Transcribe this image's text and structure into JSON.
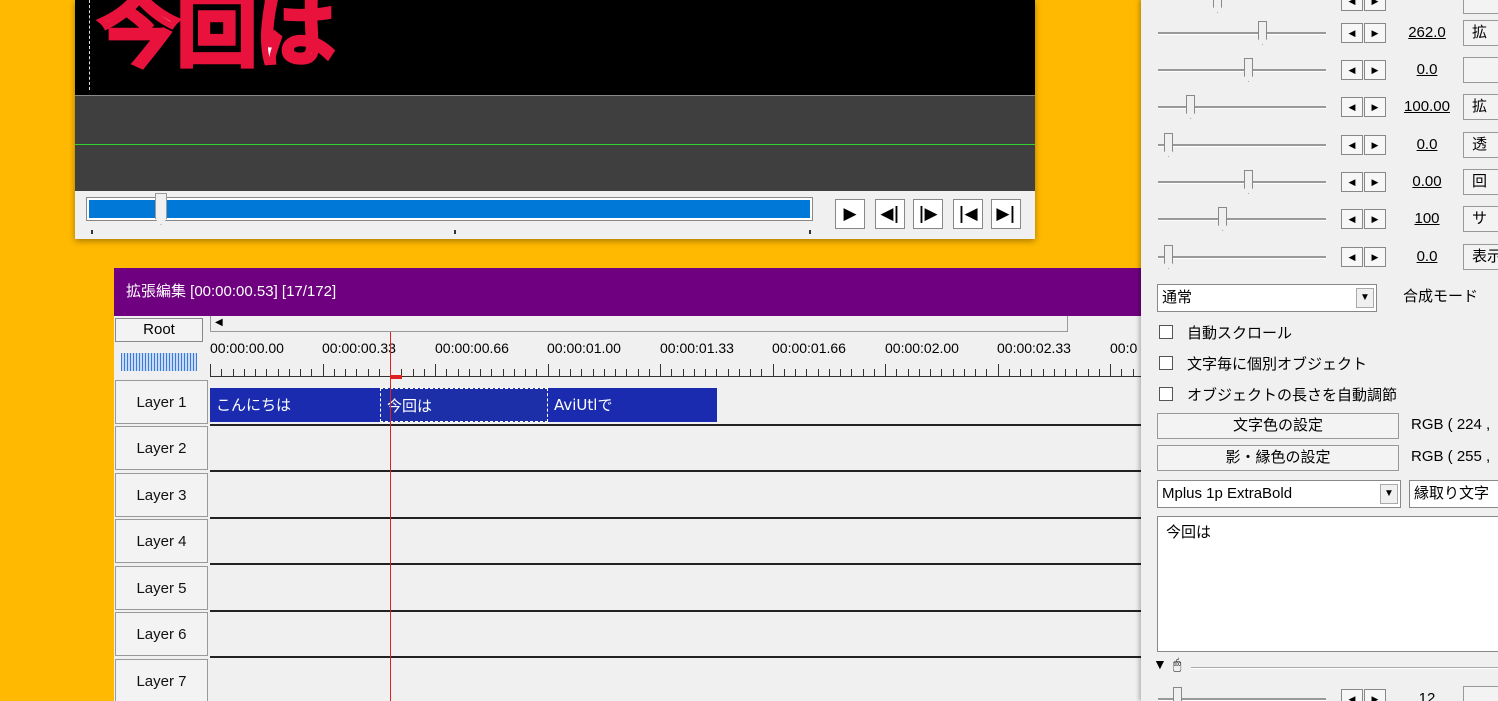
{
  "preview": {
    "canvas_text": "今回は",
    "buttons": [
      {
        "name": "play-icon",
        "glyph": "▶"
      },
      {
        "name": "step-back-icon",
        "glyph": "◀|"
      },
      {
        "name": "step-forward-icon",
        "glyph": "|▶"
      },
      {
        "name": "jump-start-icon",
        "glyph": "|◀"
      },
      {
        "name": "jump-end-icon",
        "glyph": "▶|"
      }
    ],
    "seek_position": 0.11
  },
  "timeline": {
    "title": "拡張編集 [00:00:00.53] [17/172]",
    "root_label": "Root",
    "time_labels": [
      "00:00:00.00",
      "00:00:00.33",
      "00:00:00.66",
      "00:00:01.00",
      "00:00:01.33",
      "00:00:01.66",
      "00:00:02.00",
      "00:00:02.33",
      "00:0"
    ],
    "layers": [
      "Layer 1",
      "Layer 2",
      "Layer 3",
      "Layer 4",
      "Layer 5",
      "Layer 6",
      "Layer 7"
    ],
    "clips": [
      {
        "label": "こんにちは",
        "selected": false
      },
      {
        "label": "今回は",
        "selected": true
      },
      {
        "label": "AviUtlで",
        "selected": false
      }
    ],
    "colors": {
      "title_bar": "#6f0080",
      "clip": "#1a2bb0",
      "playhead": "#e02020"
    }
  },
  "properties": {
    "slider_rows": [
      {
        "value": "262.0",
        "button": "拡"
      },
      {
        "value": "0.0",
        "button": ""
      },
      {
        "value": "100.00",
        "button": "拡"
      },
      {
        "value": "0.0",
        "button": "透"
      },
      {
        "value": "0.00",
        "button": "回"
      },
      {
        "value": "100",
        "button": "サ"
      },
      {
        "value": "0.0",
        "button": "表示"
      }
    ],
    "blend_select": "通常",
    "blend_label": "合成モード",
    "checkboxes": [
      "自動スクロール",
      "文字毎に個別オブジェクト",
      "オブジェクトの長さを自動調節"
    ],
    "text_color_button": "文字色の設定",
    "text_color_value": "RGB ( 224 ,",
    "shadow_color_button": "影・縁色の設定",
    "shadow_color_value": "RGB ( 255 ,",
    "font_select": "Mplus 1p ExtraBold",
    "style_select": "縁取り文字",
    "text_content": "今回は",
    "bottom_value": "12"
  }
}
